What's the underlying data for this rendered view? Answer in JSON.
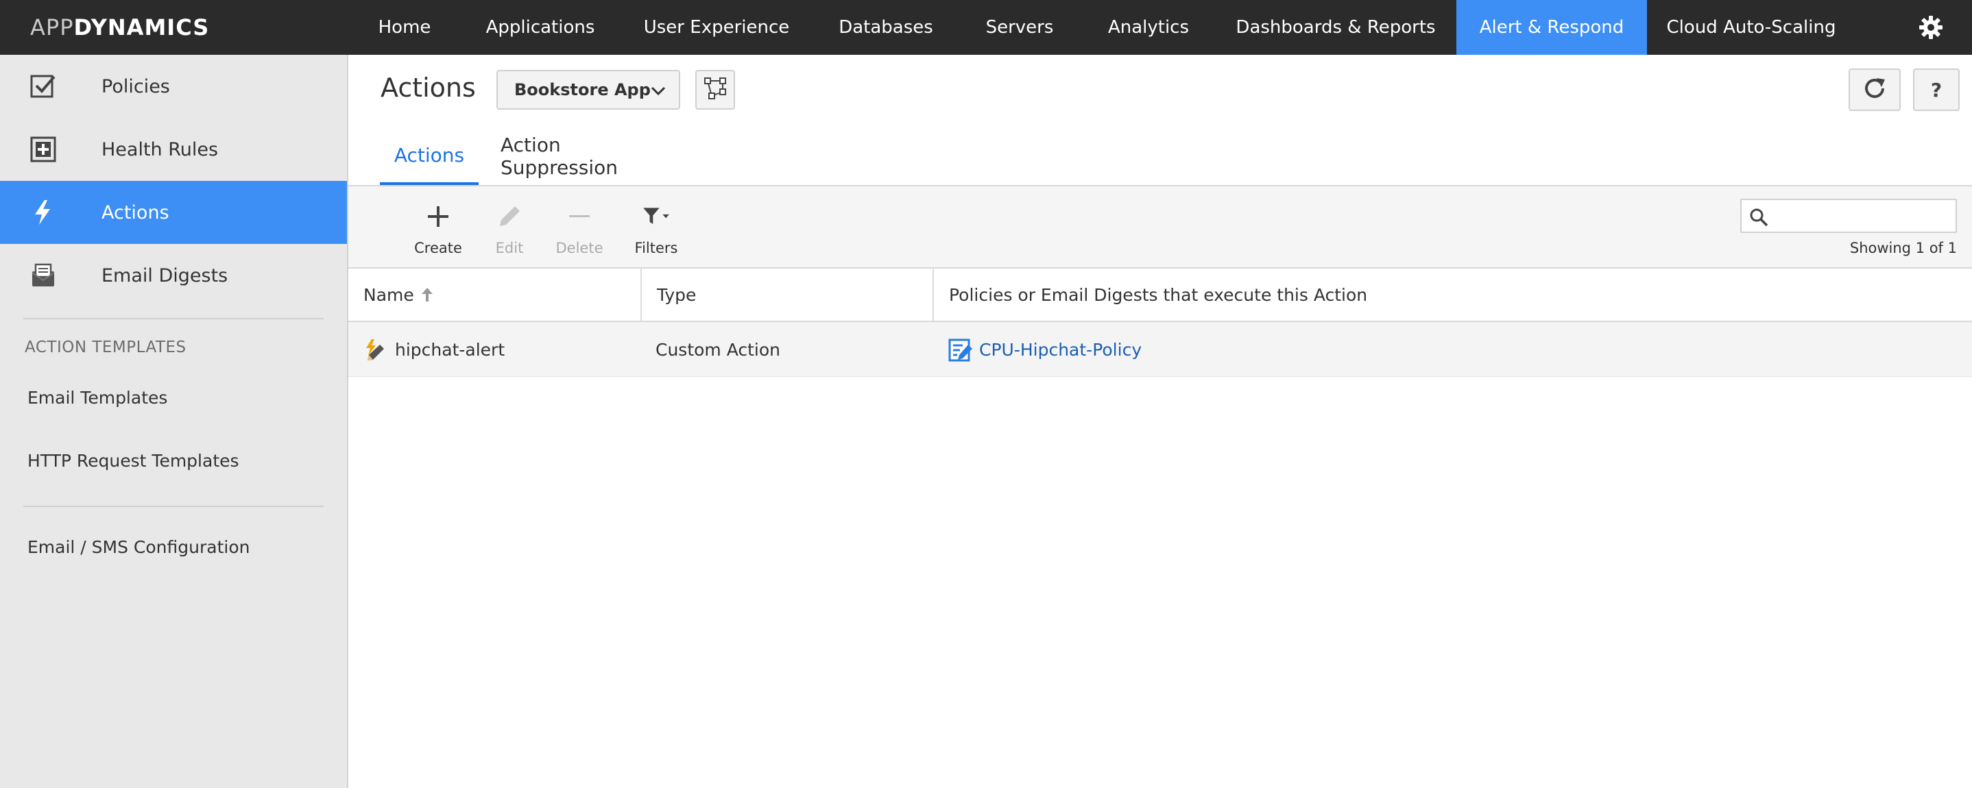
{
  "brand": {
    "part1": "APP",
    "part2": "DYNAMICS"
  },
  "topnav": {
    "items": [
      {
        "label": "Home"
      },
      {
        "label": "Applications"
      },
      {
        "label": "User Experience"
      },
      {
        "label": "Databases"
      },
      {
        "label": "Servers"
      },
      {
        "label": "Analytics"
      },
      {
        "label": "Dashboards & Reports"
      },
      {
        "label": "Alert & Respond",
        "active": true
      },
      {
        "label": "Cloud Auto-Scaling"
      }
    ],
    "settings_icon": "gear-icon"
  },
  "sidebar": {
    "items": [
      {
        "label": "Policies",
        "icon": "checkbox-icon"
      },
      {
        "label": "Health Rules",
        "icon": "plus-square-icon"
      },
      {
        "label": "Actions",
        "icon": "lightning-icon",
        "active": true
      },
      {
        "label": "Email Digests",
        "icon": "email-digest-icon"
      }
    ],
    "section_header": "ACTION TEMPLATES",
    "templates": [
      {
        "label": "Email Templates"
      },
      {
        "label": "HTTP Request Templates"
      }
    ],
    "config_link": "Email / SMS Configuration"
  },
  "header": {
    "title": "Actions",
    "app_selector": "Bookstore App",
    "flowmap_icon": "flowmap-icon",
    "refresh_icon": "refresh-icon",
    "help_label": "?"
  },
  "tabs": [
    {
      "label": "Actions",
      "active": true
    },
    {
      "label": "Action Suppression"
    }
  ],
  "toolbar": {
    "create": "Create",
    "edit": "Edit",
    "delete": "Delete",
    "filters": "Filters",
    "search_placeholder": "",
    "showing": "Showing 1 of 1"
  },
  "table": {
    "columns": [
      "Name",
      "Type",
      "Policies or Email Digests that execute this Action"
    ],
    "sort": {
      "column": "Name",
      "direction": "ascending"
    },
    "rows": [
      {
        "name": "hipchat-alert",
        "type": "Custom Action",
        "policy": "CPU-Hipchat-Policy"
      }
    ]
  },
  "colors": {
    "accent": "#3d8ff5",
    "topbar": "#2b2b2b",
    "sidebar": "#e8e8e8",
    "link": "#1a5fb4"
  }
}
